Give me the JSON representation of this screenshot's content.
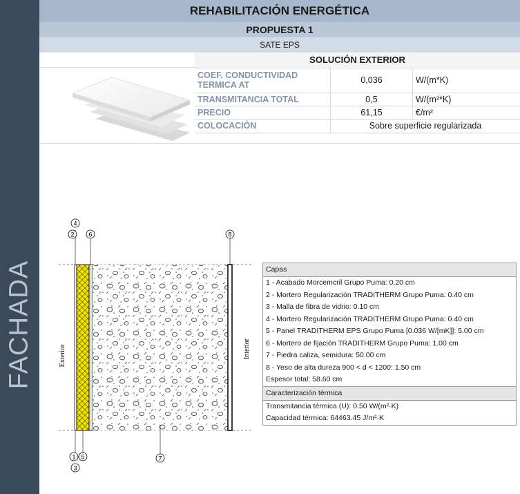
{
  "sidebar": {
    "label": "FACHADA"
  },
  "header": {
    "title": "REHABILITACIÓN ENERGÉTICA",
    "subtitle": "PROPUESTA 1",
    "system": "SATE EPS",
    "section": "SOLUCIÓN EXTERIOR"
  },
  "properties": [
    {
      "label": "COEF. CONDUCTIVIDAD TERMICA AT",
      "value": "0,036",
      "unit": "W/(m*K)"
    },
    {
      "label": "TRANSMITANCIA TOTAL",
      "value": "0,5",
      "unit": "W/(m²*K)"
    },
    {
      "label": "PRECIO",
      "value": "61,15",
      "unit": "€/m²"
    },
    {
      "label": "COLOCACIÓN",
      "value": "Sobre superficie regularizada"
    }
  ],
  "diagram": {
    "exterior_label": "Exterior",
    "interior_label": "Interior",
    "markers_top": [
      "4",
      "2",
      "6",
      "8"
    ],
    "markers_bottom": [
      "1",
      "5",
      "3",
      "7"
    ]
  },
  "legend": {
    "layers_header": "Capas",
    "layers": [
      "1 - Acabado Morcemcril Grupo Puma: 0.20 cm",
      "2 - Mortero Regularización TRADITHERM Grupo Puma: 0.40 cm",
      "3 - Malla de fibra de vidrio: 0.10 cm",
      "4 - Mortero Regularización TRADITHERM Grupo Puma: 0.40 cm",
      "5 - Panel TRADITHERM EPS Grupo Puma [0.036 W/[mK]]: 5.00 cm",
      "6 - Mortero de fijación TRADITHERM Grupo Puma: 1.00 cm",
      "7 - Piedra caliza, semidura: 50.00 cm",
      "8 - Yeso de alta dureza 900 < d < 1200: 1.50 cm"
    ],
    "total": "Espesor total: 58.60 cm",
    "thermal_header": "Caracterización térmica",
    "thermal": [
      "Transmitancia térmica (U): 0.50 W/(m²·K)",
      "Capacidad térmica: 64463.45 J/m²·K"
    ]
  }
}
